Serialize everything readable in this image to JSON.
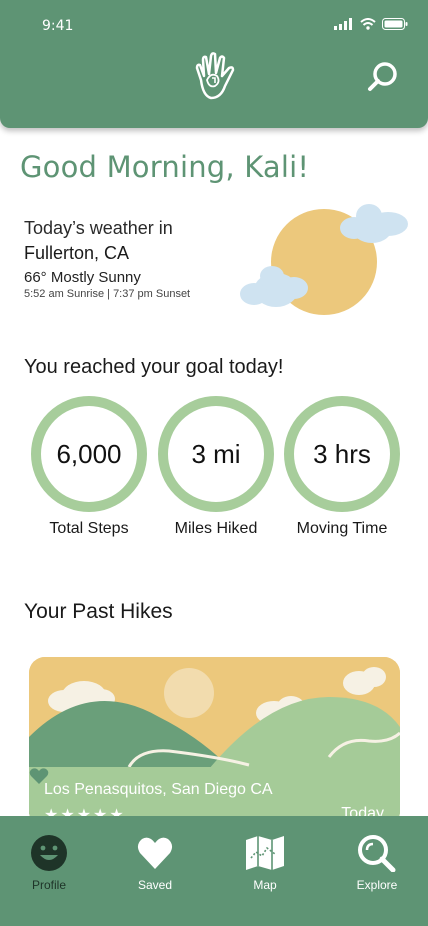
{
  "status_bar": {
    "time": "9:41"
  },
  "greeting": "Good Morning, Kali!",
  "weather": {
    "intro": "Today’s weather in",
    "city": "Fullerton, CA",
    "condition": "66° Mostly Sunny",
    "sun_times": "5:52 am Sunrise | 7:37 pm Sunset"
  },
  "goal": {
    "title": "You reached your goal today!",
    "stats": [
      {
        "value": "6,000",
        "label": "Total Steps"
      },
      {
        "value": "3 mi",
        "label": "Miles Hiked"
      },
      {
        "value": "3 hrs",
        "label": "Moving Time"
      }
    ]
  },
  "past_hikes": {
    "title": "Your Past Hikes",
    "items": [
      {
        "location": "Los Penasquitos, San Diego CA",
        "stars": "★★★★★",
        "date": "Today"
      }
    ]
  },
  "nav": {
    "items": [
      {
        "label": "Profile",
        "icon": "profile-icon"
      },
      {
        "label": "Saved",
        "icon": "heart-icon"
      },
      {
        "label": "Map",
        "icon": "map-icon"
      },
      {
        "label": "Explore",
        "icon": "explore-icon"
      }
    ]
  },
  "colors": {
    "primary": "#5e9474",
    "ring": "#a7cd9b",
    "sun": "#ecc87c",
    "card_footer": "#a5cb98"
  }
}
